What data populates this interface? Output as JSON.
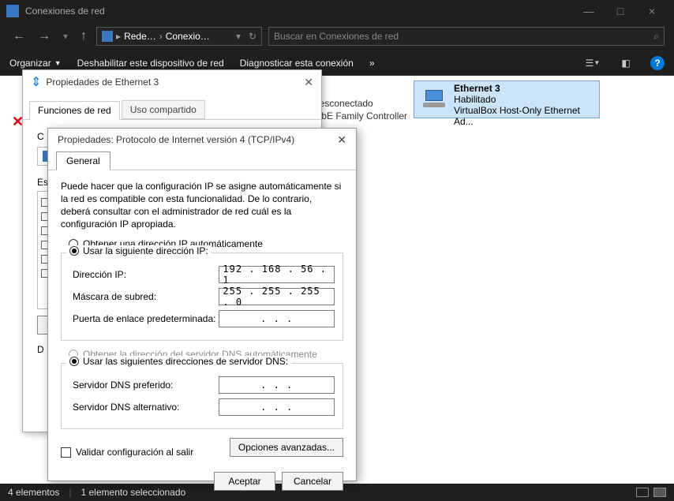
{
  "window": {
    "title": "Conexiones de red",
    "minimize": "—",
    "maximize": "□",
    "close": "×"
  },
  "nav": {
    "back": "←",
    "forward": "→",
    "up": "↑",
    "breadcrumb_root": "Rede…",
    "breadcrumb_current": "Conexio…",
    "refresh": "↻",
    "search_placeholder": "Buscar en Conexiones de red",
    "search_icon": "🔍"
  },
  "commands": {
    "organize": "Organizar",
    "disable": "Deshabilitar este dispositivo de red",
    "diagnose": "Diagnosticar esta conexión",
    "more": "»",
    "help": "?"
  },
  "hidden_adapter": {
    "line1": "d desconectado",
    "line2": "e GbE Family Controller"
  },
  "adapter": {
    "name": "Ethernet 3",
    "status": "Habilitado",
    "desc": "VirtualBox Host-Only Ethernet Ad..."
  },
  "prop_eth": {
    "title": "Propiedades de Ethernet 3",
    "tab_net": "Funciones de red",
    "tab_share": "Uso compartido",
    "connect_label": "C",
    "this_conn": "Es"
  },
  "ipv4": {
    "title": "Propiedades: Protocolo de Internet versión 4 (TCP/IPv4)",
    "tab_general": "General",
    "intro": "Puede hacer que la configuración IP se asigne automáticamente si la red es compatible con esta funcionalidad. De lo contrario, deberá consultar con el administrador de red cuál es la configuración IP apropiada.",
    "radio_auto_ip": "Obtener una dirección IP automáticamente",
    "radio_static_ip": "Usar la siguiente dirección IP:",
    "label_ip": "Dirección IP:",
    "value_ip": "192 . 168 .  56 .   1",
    "label_mask": "Máscara de subred:",
    "value_mask": "255 . 255 . 255 .   0",
    "label_gateway": "Puerta de enlace predeterminada:",
    "value_gateway": ".         .         .",
    "radio_auto_dns": "Obtener la dirección del servidor DNS automáticamente",
    "radio_static_dns": "Usar las siguientes direcciones de servidor DNS:",
    "label_dns1": "Servidor DNS preferido:",
    "value_dns1": ".         .         .",
    "label_dns2": "Servidor DNS alternativo:",
    "value_dns2": ".         .         .",
    "validate": "Validar configuración al salir",
    "advanced": "Opciones avanzadas...",
    "ok": "Aceptar",
    "cancel": "Cancelar"
  },
  "status": {
    "count": "4 elementos",
    "selected": "1 elemento seleccionado"
  }
}
